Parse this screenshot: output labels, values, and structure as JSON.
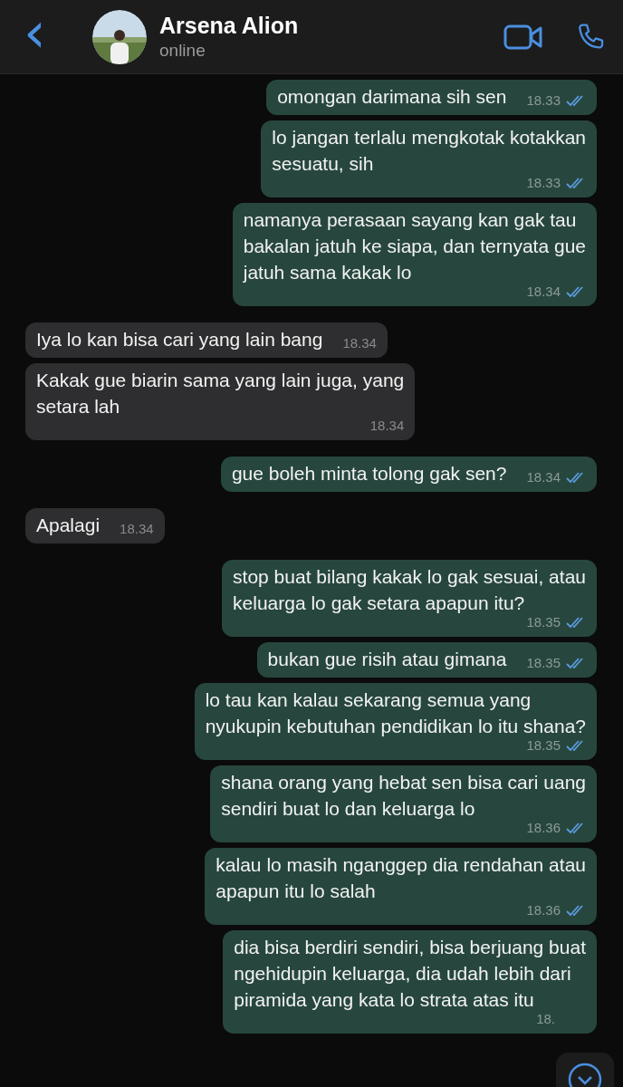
{
  "header": {
    "back": "‹",
    "name": "Arsena Alion",
    "status": "online"
  },
  "messages": [
    {
      "kind": "out",
      "text": "omongan darimana sih sen",
      "time": "18.33",
      "read": true
    },
    {
      "kind": "out",
      "text": "lo jangan terlalu mengkotak kotakkan\nsesuatu, sih",
      "time": "18.33",
      "read": true
    },
    {
      "kind": "out",
      "text": "namanya perasaan sayang kan gak tau\nbakalan jatuh ke siapa, dan ternyata gue\njatuh sama kakak lo",
      "time": "18.34",
      "read": true
    },
    {
      "kind": "in",
      "text": "Iya lo kan bisa cari yang lain bang",
      "time": "18.34"
    },
    {
      "kind": "in",
      "text": "Kakak gue biarin sama yang lain juga, yang\nsetara lah",
      "time": "18.34"
    },
    {
      "kind": "out",
      "text": "gue boleh minta tolong gak sen?",
      "time": "18.34",
      "read": true
    },
    {
      "kind": "in",
      "text": "Apalagi",
      "time": "18.34"
    },
    {
      "kind": "out",
      "text": "stop buat bilang kakak lo gak sesuai, atau\nkeluarga lo gak setara apapun itu?",
      "time": "18.35",
      "read": true
    },
    {
      "kind": "out",
      "text": "bukan gue risih atau gimana",
      "time": "18.35",
      "read": true
    },
    {
      "kind": "out",
      "text": "lo tau kan kalau sekarang semua yang\nnyukupin kebutuhan pendidikan lo itu shana?",
      "time": "18.35",
      "read": true
    },
    {
      "kind": "out",
      "text": "shana orang yang hebat sen bisa cari uang\nsendiri buat lo dan keluarga lo",
      "time": "18.36",
      "read": true
    },
    {
      "kind": "out",
      "text": "kalau lo masih nganggep dia rendahan atau\napapun itu lo salah",
      "time": "18.36",
      "read": true
    },
    {
      "kind": "out",
      "text": "dia bisa berdiri sendiri, bisa berjuang buat\nngehidupin keluarga, dia udah lebih dari\npiramida yang kata lo strata atas itu",
      "time": "18."
    }
  ]
}
